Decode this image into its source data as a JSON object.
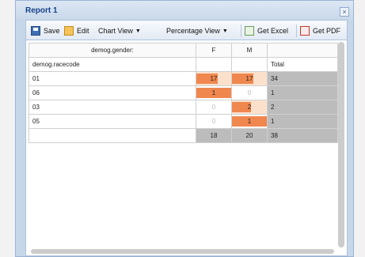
{
  "window": {
    "title": "Report 1",
    "close": "×"
  },
  "toolbar": {
    "save": "Save",
    "edit": "Edit",
    "chart_view": "Chart View",
    "percentage_view": "Percentage View",
    "get_excel": "Get Excel",
    "get_pdf": "Get PDF"
  },
  "table": {
    "col_var": "demog.gender:",
    "col_f": "F",
    "col_m": "M",
    "row_var": "demog.racecode",
    "total_label": "Total",
    "rows": [
      {
        "code": "01",
        "f": "17",
        "m": "17",
        "total": "34",
        "f_frac": 0.62,
        "m_frac": 0.62
      },
      {
        "code": "06",
        "f": "1",
        "m": "0",
        "total": "1",
        "f_frac": 1.0,
        "m_frac": 0
      },
      {
        "code": "03",
        "f": "0",
        "m": "2",
        "total": "2",
        "f_frac": 0,
        "m_frac": 0.55
      },
      {
        "code": "05",
        "f": "0",
        "m": "1",
        "total": "1",
        "f_frac": 0,
        "m_frac": 1.0
      }
    ],
    "totals": {
      "f": "18",
      "m": "20",
      "total": "38"
    }
  },
  "colors": {
    "bar": "#f0874f",
    "bar_light": "#fbe1cc",
    "total_bg": "#bcbcbc",
    "title": "#15428b"
  }
}
